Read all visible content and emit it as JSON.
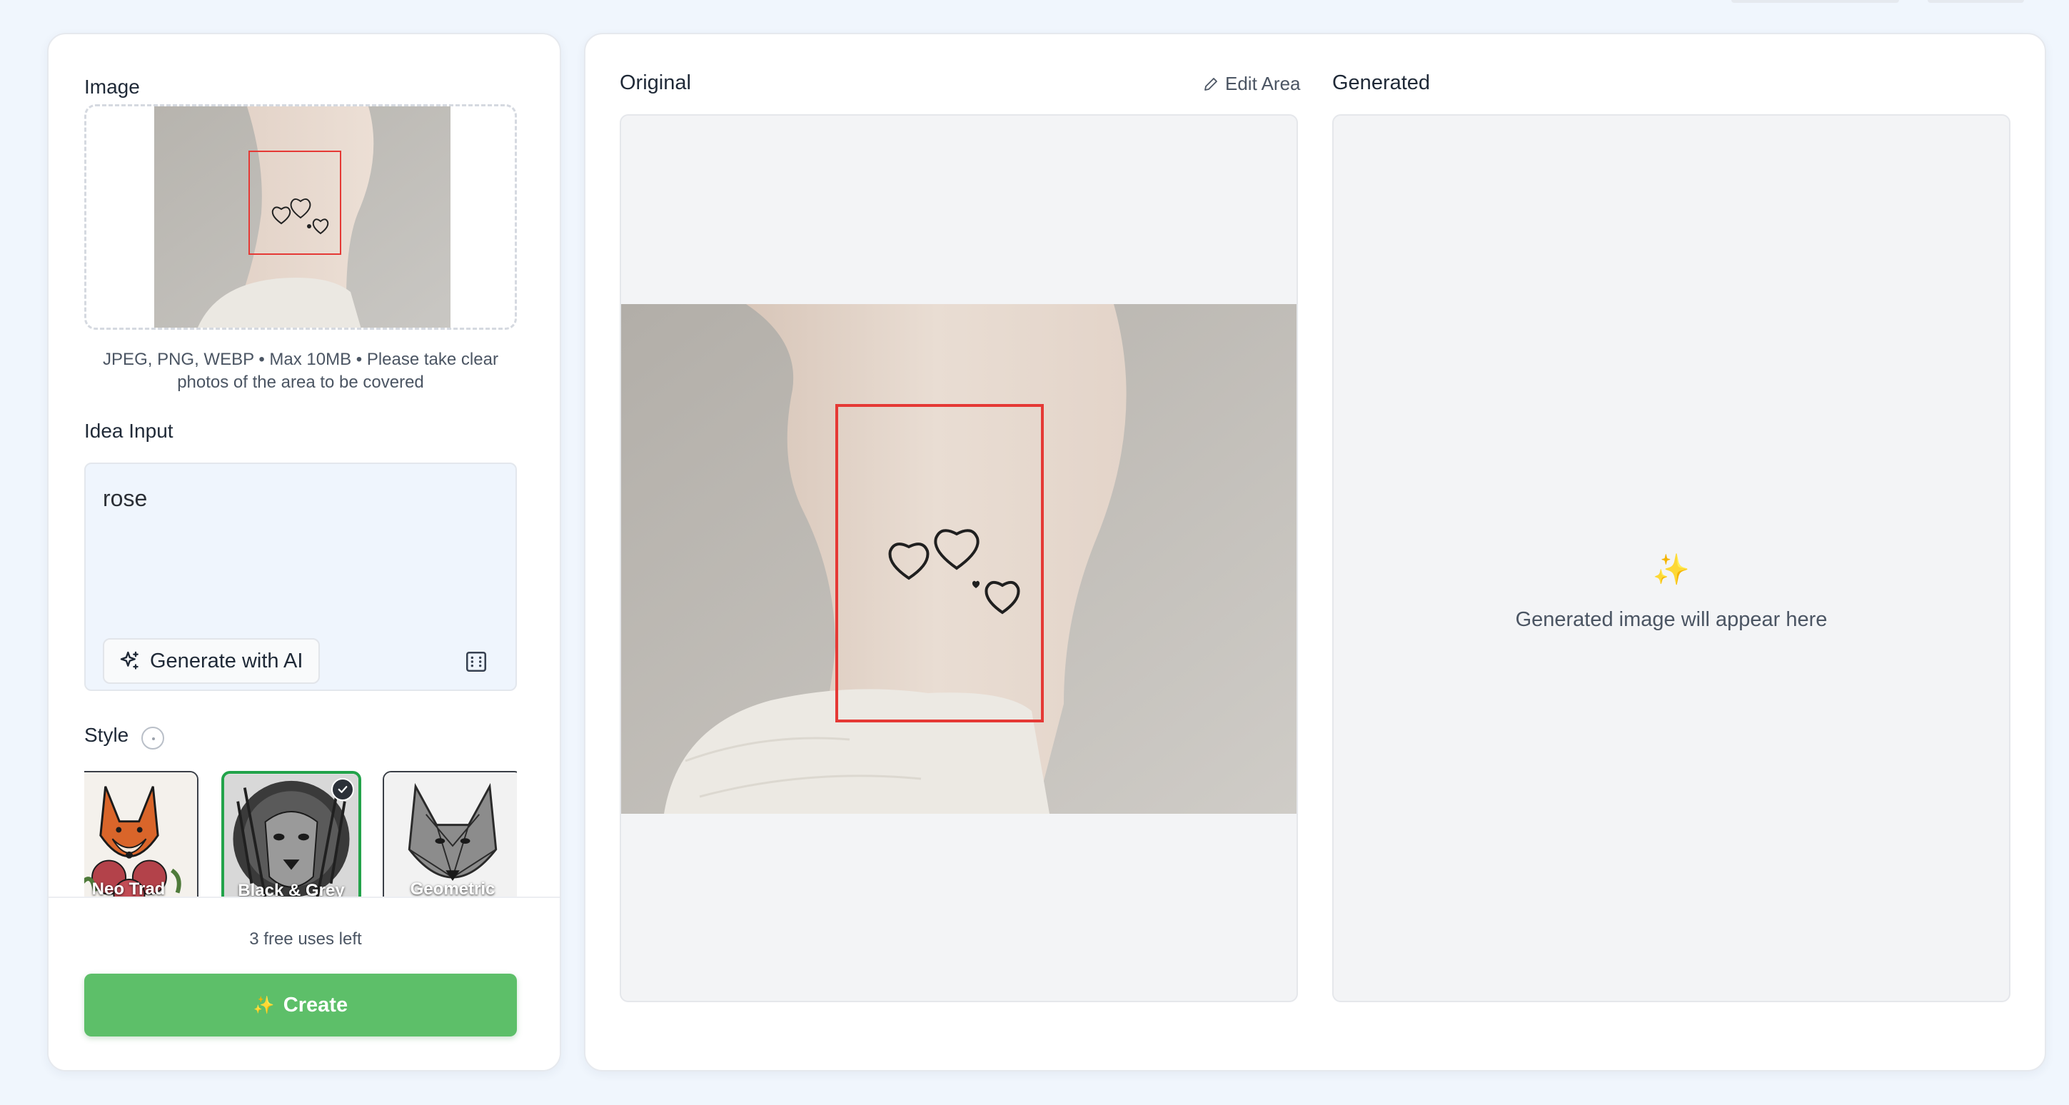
{
  "left_panel": {
    "image_label": "Image",
    "upload_help": "JPEG, PNG, WEBP • Max 10MB • Please take clear photos of the area to be covered",
    "idea_label": "Idea Input",
    "idea_value": "rose",
    "generate_ai_label": "Generate with AI",
    "style_label": "Style",
    "styles": [
      {
        "name": "Neo Trad",
        "selected": false
      },
      {
        "name": "Black & Grey",
        "selected": true
      },
      {
        "name": "Geometric",
        "selected": false
      }
    ],
    "free_uses": "3 free uses left",
    "create_label": "Create"
  },
  "right_panel": {
    "original_title": "Original",
    "edit_area_label": "Edit Area",
    "generated_title": "Generated",
    "generated_placeholder": "Generated image will appear here"
  },
  "colors": {
    "background": "#f0f6fd",
    "primary_green": "#5dbf69",
    "selected_border": "#22a34a",
    "selection_rect": "#e53935"
  },
  "icons": [
    "sparkles-icon",
    "expand-icon",
    "info-icon",
    "pencil-icon",
    "check-icon"
  ]
}
